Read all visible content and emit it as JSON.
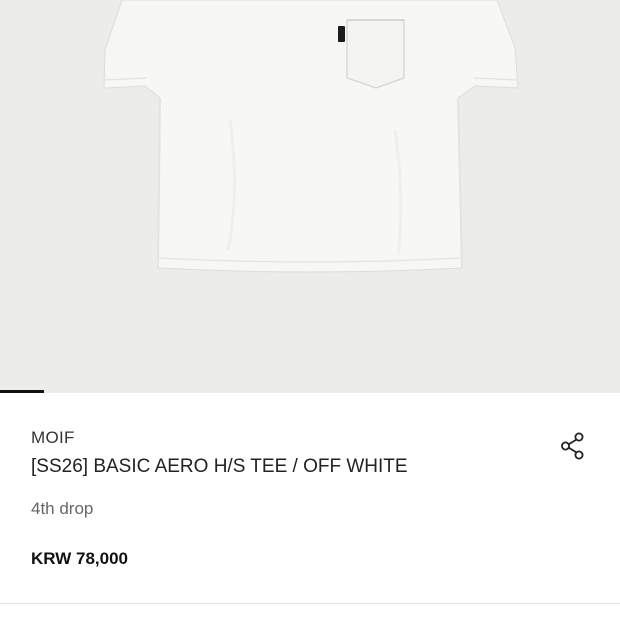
{
  "product": {
    "brand": "MOIF",
    "name": "[SS26] BASIC AERO H/S TEE / OFF WHITE",
    "subtitle": "4th drop",
    "price": "KRW 78,000"
  },
  "gallery": {
    "image_subject": "off-white t-shirt with chest pocket",
    "active_index": 0
  },
  "icons": {
    "share": "share-icon"
  },
  "colors": {
    "hero_background": "#ececeb",
    "garment": "#f7f7f5",
    "indicator": "#111111",
    "text_primary": "#222222",
    "text_secondary": "#666666"
  }
}
